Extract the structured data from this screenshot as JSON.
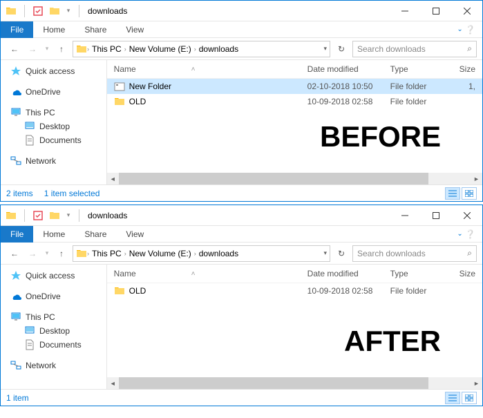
{
  "before": {
    "title": "downloads",
    "file_tab": "File",
    "tabs": [
      "Home",
      "Share",
      "View"
    ],
    "breadcrumbs": [
      "This PC",
      "New Volume (E:)",
      "downloads"
    ],
    "search_placeholder": "Search downloads",
    "columns": {
      "name": "Name",
      "date": "Date modified",
      "type": "Type",
      "size": "Size"
    },
    "files": [
      {
        "name": "New Folder",
        "date": "02-10-2018 10:50",
        "type": "File folder",
        "size": "1,",
        "selected": true
      },
      {
        "name": "OLD",
        "date": "10-09-2018 02:58",
        "type": "File folder",
        "size": "",
        "selected": false
      }
    ],
    "sidebar": {
      "quick_access": "Quick access",
      "onedrive": "OneDrive",
      "this_pc": "This PC",
      "desktop": "Desktop",
      "documents": "Documents",
      "network": "Network"
    },
    "status_count": "2 items",
    "status_selected": "1 item selected",
    "overlay": "BEFORE"
  },
  "after": {
    "title": "downloads",
    "file_tab": "File",
    "tabs": [
      "Home",
      "Share",
      "View"
    ],
    "breadcrumbs": [
      "This PC",
      "New Volume (E:)",
      "downloads"
    ],
    "search_placeholder": "Search downloads",
    "columns": {
      "name": "Name",
      "date": "Date modified",
      "type": "Type",
      "size": "Size"
    },
    "files": [
      {
        "name": "OLD",
        "date": "10-09-2018 02:58",
        "type": "File folder",
        "size": "",
        "selected": false
      }
    ],
    "sidebar": {
      "quick_access": "Quick access",
      "onedrive": "OneDrive",
      "this_pc": "This PC",
      "desktop": "Desktop",
      "documents": "Documents",
      "network": "Network"
    },
    "status_count": "1 item",
    "overlay": "AFTER"
  }
}
